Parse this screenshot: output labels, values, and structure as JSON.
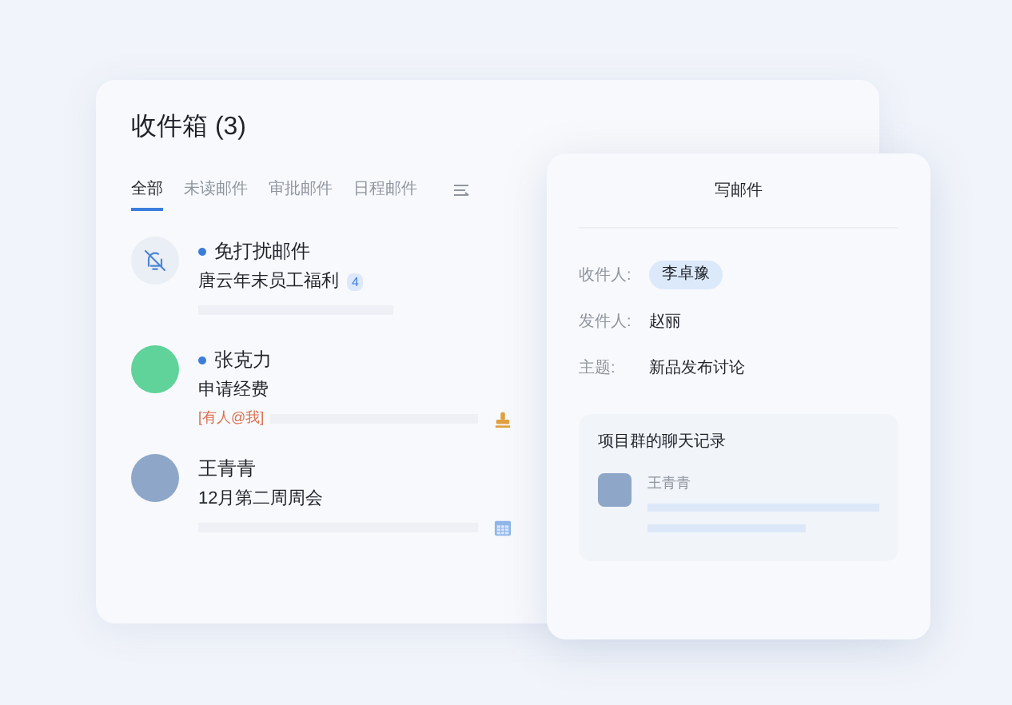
{
  "inbox": {
    "title": "收件箱 (3)",
    "tabs": [
      {
        "label": "全部",
        "selected": true
      },
      {
        "label": "未读邮件",
        "selected": false
      },
      {
        "label": "审批邮件",
        "selected": false
      },
      {
        "label": "日程邮件",
        "selected": false
      }
    ],
    "mails": [
      {
        "kind": "muted",
        "sender": "免打扰邮件",
        "unread": true,
        "subject": "唐云年末员工福利",
        "badge": "4"
      },
      {
        "kind": "approval",
        "sender": "张克力",
        "unread": true,
        "subject": "申请经费",
        "tag": "[有人@我]"
      },
      {
        "kind": "schedule",
        "sender": "王青青",
        "unread": false,
        "subject": "12月第二周周会"
      }
    ]
  },
  "compose": {
    "title": "写邮件",
    "fields": [
      {
        "kind": "chip",
        "label": "收件人:",
        "value": "李卓豫"
      },
      {
        "kind": "text",
        "label": "发件人:",
        "value": "赵丽"
      },
      {
        "kind": "text",
        "label": "主题:",
        "value": "新品发布讨论"
      }
    ],
    "chat_record": {
      "title": "项目群的聊天记录",
      "sender": "王青青"
    }
  }
}
